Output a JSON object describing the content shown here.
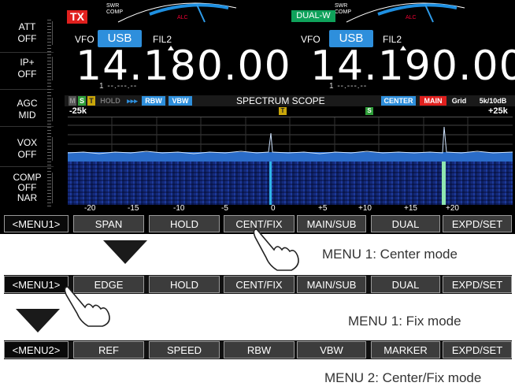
{
  "side_buttons": [
    {
      "key": "ATT",
      "value": "OFF"
    },
    {
      "key": "IP+",
      "value": "OFF"
    },
    {
      "key": "AGC",
      "value": "MID"
    },
    {
      "key": "VOX",
      "value": "OFF"
    },
    {
      "key": "COMP",
      "value": "OFF",
      "extra": "NAR"
    }
  ],
  "status": {
    "tx": "TX",
    "dual": "DUAL-W"
  },
  "main": {
    "vfo": "VFO",
    "mode": "USB",
    "filter": "FIL2",
    "frequency": "14.180.00",
    "memory": "1 --.---.--"
  },
  "sub": {
    "vfo": "VFO",
    "mode": "USB",
    "filter": "FIL2",
    "frequency": "14.190.00",
    "memory": "1 --.---.--"
  },
  "scope": {
    "tags": [
      "M",
      "S",
      "T",
      "HOLD",
      "▸▸▸",
      "RBW",
      "VBW"
    ],
    "title": "SPECTRUM SCOPE",
    "center": "CENTER",
    "main": "MAIN",
    "grid": "Grid",
    "span_info": "5k/10dB",
    "left_edge": "-25k",
    "right_edge": "+25k",
    "marker_t": "T",
    "marker_s": "S",
    "axis": [
      "-20",
      "-15",
      "-10",
      "-5",
      "0",
      "+5",
      "+10",
      "+15",
      "+20"
    ]
  },
  "menu_center": [
    "<MENU1>",
    "SPAN",
    "HOLD",
    "CENT/FIX",
    "MAIN/SUB",
    "DUAL",
    "EXPD/SET"
  ],
  "menu_fix": [
    "<MENU1>",
    "EDGE",
    "HOLD",
    "CENT/FIX",
    "MAIN/SUB",
    "DUAL",
    "EXPD/SET"
  ],
  "menu_2": [
    "<MENU2>",
    "REF",
    "SPEED",
    "RBW",
    "VBW",
    "MARKER",
    "EXPD/SET"
  ],
  "captions": {
    "center": "MENU 1: Center mode",
    "fix": "MENU 1: Fix mode",
    "menu2": "MENU 2: Center/Fix mode"
  },
  "colors": {
    "tx": "#e0201e",
    "dual": "#0fa25b",
    "mode": "#2e8fdc",
    "waterfall": "#15307d"
  }
}
